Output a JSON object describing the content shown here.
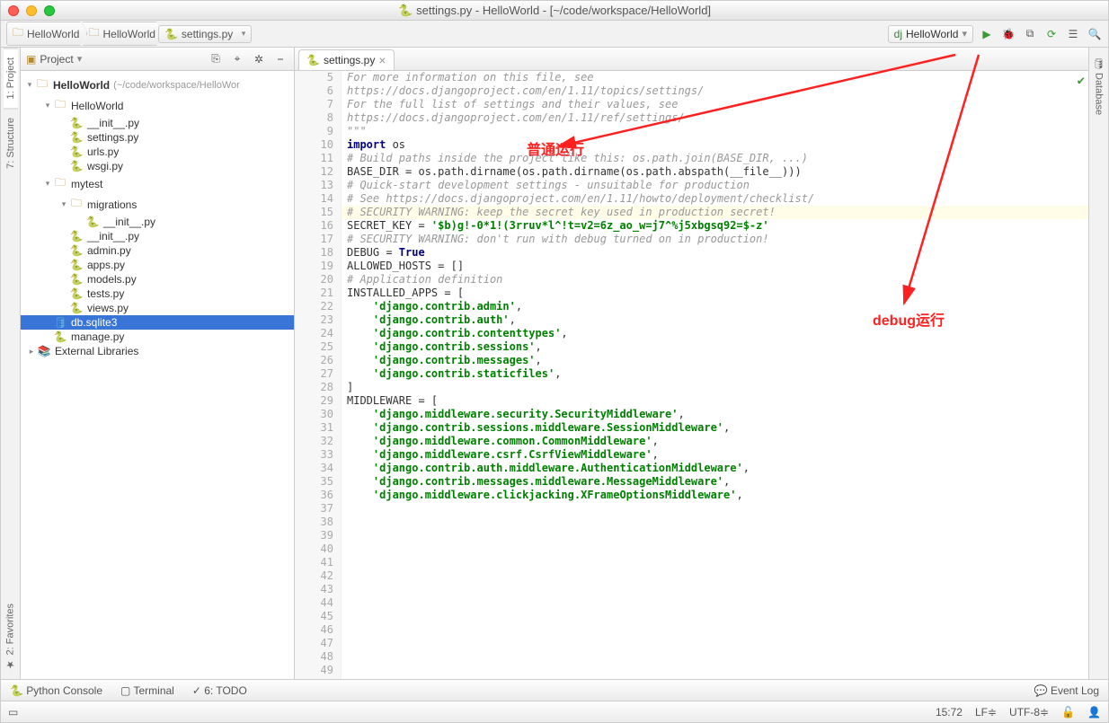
{
  "title": "settings.py - HelloWorld - [~/code/workspace/HelloWorld]",
  "breadcrumbs": [
    "HelloWorld",
    "HelloWorld",
    "settings.py"
  ],
  "runConfig": "HelloWorld",
  "leftTabs": {
    "project": "1: Project",
    "structure": "7: Structure",
    "favorites": "2: Favorites"
  },
  "rightTabs": {
    "database": "Database"
  },
  "panel": {
    "title": "Project"
  },
  "tree": {
    "root": {
      "label": "HelloWorld",
      "path": "(~/code/workspace/HelloWor"
    },
    "nodes": [
      {
        "indent": 1,
        "exp": true,
        "icon": "folder",
        "label": "HelloWorld"
      },
      {
        "indent": 2,
        "icon": "py",
        "label": "__init__.py"
      },
      {
        "indent": 2,
        "icon": "py",
        "label": "settings.py"
      },
      {
        "indent": 2,
        "icon": "py",
        "label": "urls.py"
      },
      {
        "indent": 2,
        "icon": "py",
        "label": "wsgi.py"
      },
      {
        "indent": 1,
        "exp": true,
        "icon": "folder",
        "label": "mytest"
      },
      {
        "indent": 2,
        "exp": true,
        "icon": "folder",
        "label": "migrations"
      },
      {
        "indent": 3,
        "icon": "py",
        "label": "__init__.py"
      },
      {
        "indent": 2,
        "icon": "py",
        "label": "__init__.py"
      },
      {
        "indent": 2,
        "icon": "py",
        "label": "admin.py"
      },
      {
        "indent": 2,
        "icon": "py",
        "label": "apps.py"
      },
      {
        "indent": 2,
        "icon": "py",
        "label": "models.py"
      },
      {
        "indent": 2,
        "icon": "py",
        "label": "tests.py"
      },
      {
        "indent": 2,
        "icon": "py",
        "label": "views.py"
      },
      {
        "indent": 1,
        "icon": "db",
        "label": "db.sqlite3",
        "selected": true
      },
      {
        "indent": 1,
        "icon": "py",
        "label": "manage.py"
      },
      {
        "indent": 0,
        "icon": "lib",
        "label": "External Libraries",
        "arrow": true
      }
    ]
  },
  "editor": {
    "tab": "settings.py",
    "startLine": 5,
    "highlightLine": 15,
    "lines": [
      {
        "t": ""
      },
      {
        "t": "For more information on this file, see",
        "cls": "c-comment"
      },
      {
        "t": "https://docs.djangoproject.com/en/1.11/topics/settings/",
        "cls": "c-comment"
      },
      {
        "t": ""
      },
      {
        "t": "For the full list of settings and their values, see",
        "cls": "c-comment"
      },
      {
        "t": "https://docs.djangoproject.com/en/1.11/ref/settings/",
        "cls": "c-comment"
      },
      {
        "t": "\"\"\"",
        "cls": "c-comment"
      },
      {
        "t": ""
      },
      {
        "html": "<span class='c-keyword'>import</span> os"
      },
      {
        "t": ""
      },
      {
        "html": "<span class='c-comment'># Build paths inside the project like this: os.path.join(BASE_DIR, ...)</span>"
      },
      {
        "html": "BASE_DIR = os.path.dirname(os.path.dirname(os.path.abspath(__file__)))"
      },
      {
        "t": ""
      },
      {
        "t": ""
      },
      {
        "html": "<span class='c-comment'># Quick-start development settings - unsuitable for production</span>"
      },
      {
        "html": "<span class='c-comment'># See https://docs.djangoproject.com/en/1.11/howto/deployment/checklist/</span>"
      },
      {
        "t": ""
      },
      {
        "html": "<span class='c-comment'># SECURITY WARNING: keep the secret key used in production secret!</span>"
      },
      {
        "html": "SECRET_KEY = <span class='c-string'>'$b)g!-0*1!(3rruv*l^!t=v2=6z_ao_w=j7^%j5xbgsq92=$-z'</span>"
      },
      {
        "t": ""
      },
      {
        "html": "<span class='c-comment'># SECURITY WARNING: don't run with debug turned on in production!</span>"
      },
      {
        "html": "DEBUG = <span class='c-bool'>True</span>"
      },
      {
        "t": ""
      },
      {
        "html": "ALLOWED_HOSTS = []"
      },
      {
        "t": ""
      },
      {
        "t": ""
      },
      {
        "html": "<span class='c-comment'># Application definition</span>"
      },
      {
        "t": ""
      },
      {
        "html": "INSTALLED_APPS = ["
      },
      {
        "html": "    <span class='c-string'>'django.contrib.admin'</span>,"
      },
      {
        "html": "    <span class='c-string'>'django.contrib.auth'</span>,"
      },
      {
        "html": "    <span class='c-string'>'django.contrib.contenttypes'</span>,"
      },
      {
        "html": "    <span class='c-string'>'django.contrib.sessions'</span>,"
      },
      {
        "html": "    <span class='c-string'>'django.contrib.messages'</span>,"
      },
      {
        "html": "    <span class='c-string'>'django.contrib.staticfiles'</span>,"
      },
      {
        "html": "]"
      },
      {
        "t": ""
      },
      {
        "html": "MIDDLEWARE = ["
      },
      {
        "html": "    <span class='c-string'>'django.middleware.security.SecurityMiddleware'</span>,"
      },
      {
        "html": "    <span class='c-string'>'django.contrib.sessions.middleware.SessionMiddleware'</span>,"
      },
      {
        "html": "    <span class='c-string'>'django.middleware.common.CommonMiddleware'</span>,"
      },
      {
        "html": "    <span class='c-string'>'django.middleware.csrf.CsrfViewMiddleware'</span>,"
      },
      {
        "html": "    <span class='c-string'>'django.contrib.auth.middleware.AuthenticationMiddleware'</span>,"
      },
      {
        "html": "    <span class='c-string'>'django.contrib.messages.middleware.MessageMiddleware'</span>,"
      },
      {
        "html": "    <span class='c-string'>'django.middleware.clickjacking.XFrameOptionsMiddleware'</span>,"
      },
      {
        "t": ""
      }
    ]
  },
  "bottomTools": {
    "pythonConsole": "Python Console",
    "terminal": "Terminal",
    "todo": "6: TODO"
  },
  "status": {
    "eventLog": "Event Log",
    "pos": "15:72",
    "le": "LF≑",
    "enc": "UTF-8≑"
  },
  "annotations": {
    "normal": "普通运行",
    "debug": "debug运行"
  }
}
